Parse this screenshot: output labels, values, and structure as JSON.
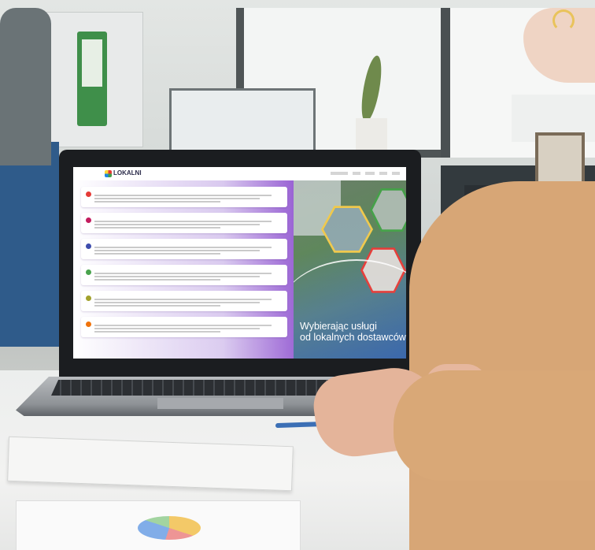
{
  "screen": {
    "logo": "LOKALNI",
    "menu_items": [
      "",
      "",
      "",
      "",
      ""
    ],
    "cards": [
      {
        "color": "#e53935"
      },
      {
        "color": "#c2185b"
      },
      {
        "color": "#3949ab"
      },
      {
        "color": "#43a047"
      },
      {
        "color": "#9e9d24"
      },
      {
        "color": "#ef6c00"
      }
    ],
    "hero": {
      "headline_line1": "Wybierając usługi",
      "headline_line2": "od lokalnych dostawców"
    }
  }
}
